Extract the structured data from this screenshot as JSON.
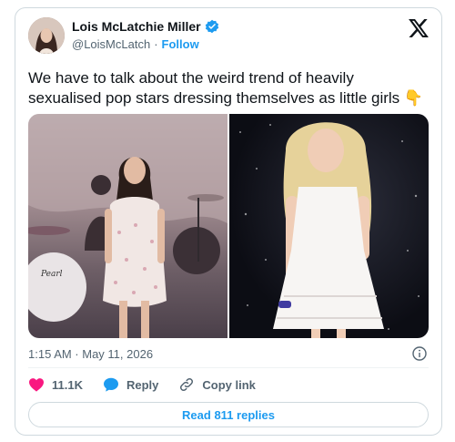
{
  "author": {
    "display_name": "Lois McLatchie Miller",
    "handle": "@LoisMcLatch",
    "separator": "·",
    "follow_label": "Follow"
  },
  "tweet": {
    "text": "We have to talk about the weird trend of heavily sexualised pop stars dressing themselves as little girls 👇"
  },
  "meta": {
    "timestamp": "1:15 AM · May 11, 2026"
  },
  "actions": {
    "likes_count": "11.1K",
    "reply_label": "Reply",
    "copy_link_label": "Copy link"
  },
  "read_replies_label": "Read 811 replies",
  "colors": {
    "accent": "#1d9bf0",
    "like": "#f91880",
    "text": "#0f1419",
    "muted": "#536471"
  },
  "icons": {
    "verified": "verified-badge-icon",
    "platform": "x-logo-icon",
    "info": "info-icon",
    "like": "heart-icon",
    "reply": "speech-bubble-icon",
    "copy_link": "link-icon"
  },
  "media_drawn_bass_drum_logo": "Pearl"
}
